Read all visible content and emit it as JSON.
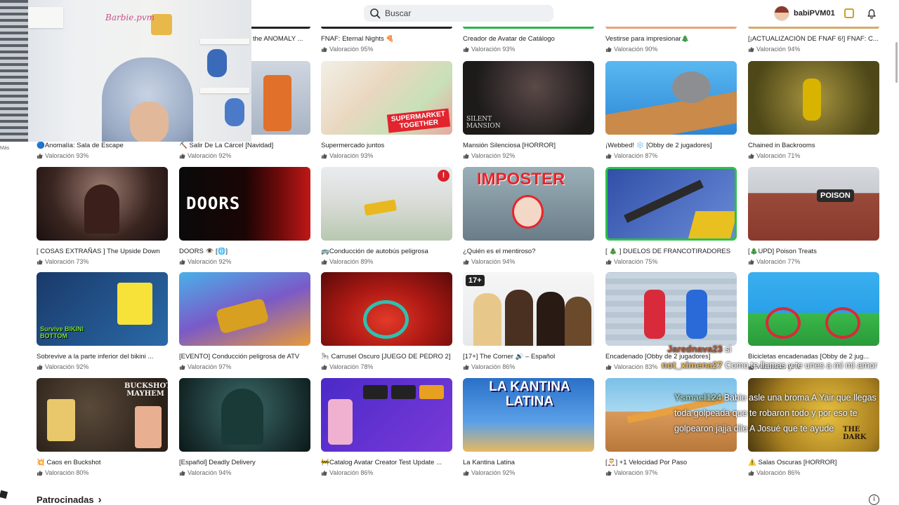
{
  "search": {
    "placeholder": "Buscar"
  },
  "user": {
    "name": "babiPVM01"
  },
  "colors": {
    "accent": "#e23a3a",
    "rating_text": "#666666",
    "chat_name": "#e8c79a"
  },
  "top_row": [
    {
      "title": "the ANOMALY ...",
      "rating": ""
    },
    {
      "title": "FNAF: Eternal Nights 🍕",
      "rating": "Valoración 95%"
    },
    {
      "title": "Creador de Avatar de Catálogo",
      "rating": "Valoración 93%"
    },
    {
      "title": "Vestirse para impresionar🎄",
      "rating": "Valoración 90%"
    },
    {
      "title": "[¡ACTUALIZACIÓN DE FNAF 6!] FNAF: C...",
      "rating": "Valoración 94%"
    }
  ],
  "rows": [
    [
      {
        "title": "🔵Anomalía: Sala de Escape",
        "rating": "Valoración 93%"
      },
      {
        "title": "⛏️ Salir De La Cárcel [Navidad]",
        "rating": "Valoración 92%"
      },
      {
        "title": "Supermercado juntos",
        "rating": "Valoración 93%",
        "label": "SUPERMARKET TOGETHER"
      },
      {
        "title": "Mansión Silenciosa [HORROR]",
        "rating": "Valoración 92%",
        "label": "SILENT MANSION"
      },
      {
        "title": "¡Webbed! ❄️ [Obby de 2 jugadores]",
        "rating": "Valoración 87%"
      },
      {
        "title": "Chained in Backrooms",
        "rating": "Valoración 71%"
      }
    ],
    [
      {
        "title": "[ COSAS EXTRAÑAS ] The Upside Down",
        "rating": "Valoración 73%"
      },
      {
        "title": "DOORS 👁️ [🌐]",
        "rating": "Valoración 92%",
        "label": "DOORS"
      },
      {
        "title": "🚌Conducción de autobús peligrosa",
        "rating": "Valoración 89%",
        "badge": "!"
      },
      {
        "title": "¿Quién es el mentiroso?",
        "rating": "Valoración 94%",
        "label": "IMPOSTER"
      },
      {
        "title": "[ 🎄 ] DUELOS DE FRANCOTIRADORES",
        "rating": "Valoración 75%"
      },
      {
        "title": "[🎄UPD] Poison Treats",
        "rating": "Valoración 77%",
        "label": "POISON"
      }
    ],
    [
      {
        "title": "Sobrevive a la parte inferior del bikini ...",
        "rating": "Valoración 92%",
        "label": "Survive BIKINI BOTTOM"
      },
      {
        "title": "[EVENTO] Conducción peligrosa de ATV",
        "rating": "Valoración 97%"
      },
      {
        "title": "🎠 Carrusel Oscuro [JUEGO DE PEDRO 2]",
        "rating": "Valoración 78%"
      },
      {
        "title": "[17+] The Corner 🔊 – Español",
        "rating": "Valoración 86%",
        "label": "17+"
      },
      {
        "title": "Encadenado [Obby de 2 jugadores]",
        "rating": "Valoración 83%"
      },
      {
        "title": "Bicicletas encadenadas [Obby de 2 jug...",
        "rating": "Valoración 83%"
      }
    ],
    [
      {
        "title": "💥 Caos en Buckshot",
        "rating": "Valoración 80%",
        "label": "BUCKSHOT MAYHEM"
      },
      {
        "title": "[Español] Deadly Delivery",
        "rating": "Valoración 94%"
      },
      {
        "title": "🚧Catalog Avatar Creator Test Update ...",
        "rating": "Valoración 86%"
      },
      {
        "title": "La Kantina Latina",
        "rating": "Valoración 92%",
        "label": "LA KANTINA LATINA"
      },
      {
        "title": "[🎅] +1 Velocidad Por Paso",
        "rating": "Valoración 97%"
      },
      {
        "title": "⚠️ Salas Oscuras [HORROR]",
        "rating": "Valoración 86%",
        "label": "THE DARK"
      }
    ]
  ],
  "webcam": {
    "sign": "Barbie.pvm"
  },
  "chat": [
    {
      "name": "Jarednava23",
      "text": "si"
    },
    {
      "name": "not_ximena27",
      "text": "Como te llamas y te unes a mi mi amor"
    },
    {
      "name": "Ysmael124",
      "text": "Babie asle una broma A Yair que llegas toda golpeada que te robaron todo y por eso te golpearon jajja dile A Josué que te ayude"
    }
  ],
  "left_label": "Más",
  "sponsored": {
    "label": "Patrocinadas",
    "chevron": "›"
  },
  "info": "i"
}
